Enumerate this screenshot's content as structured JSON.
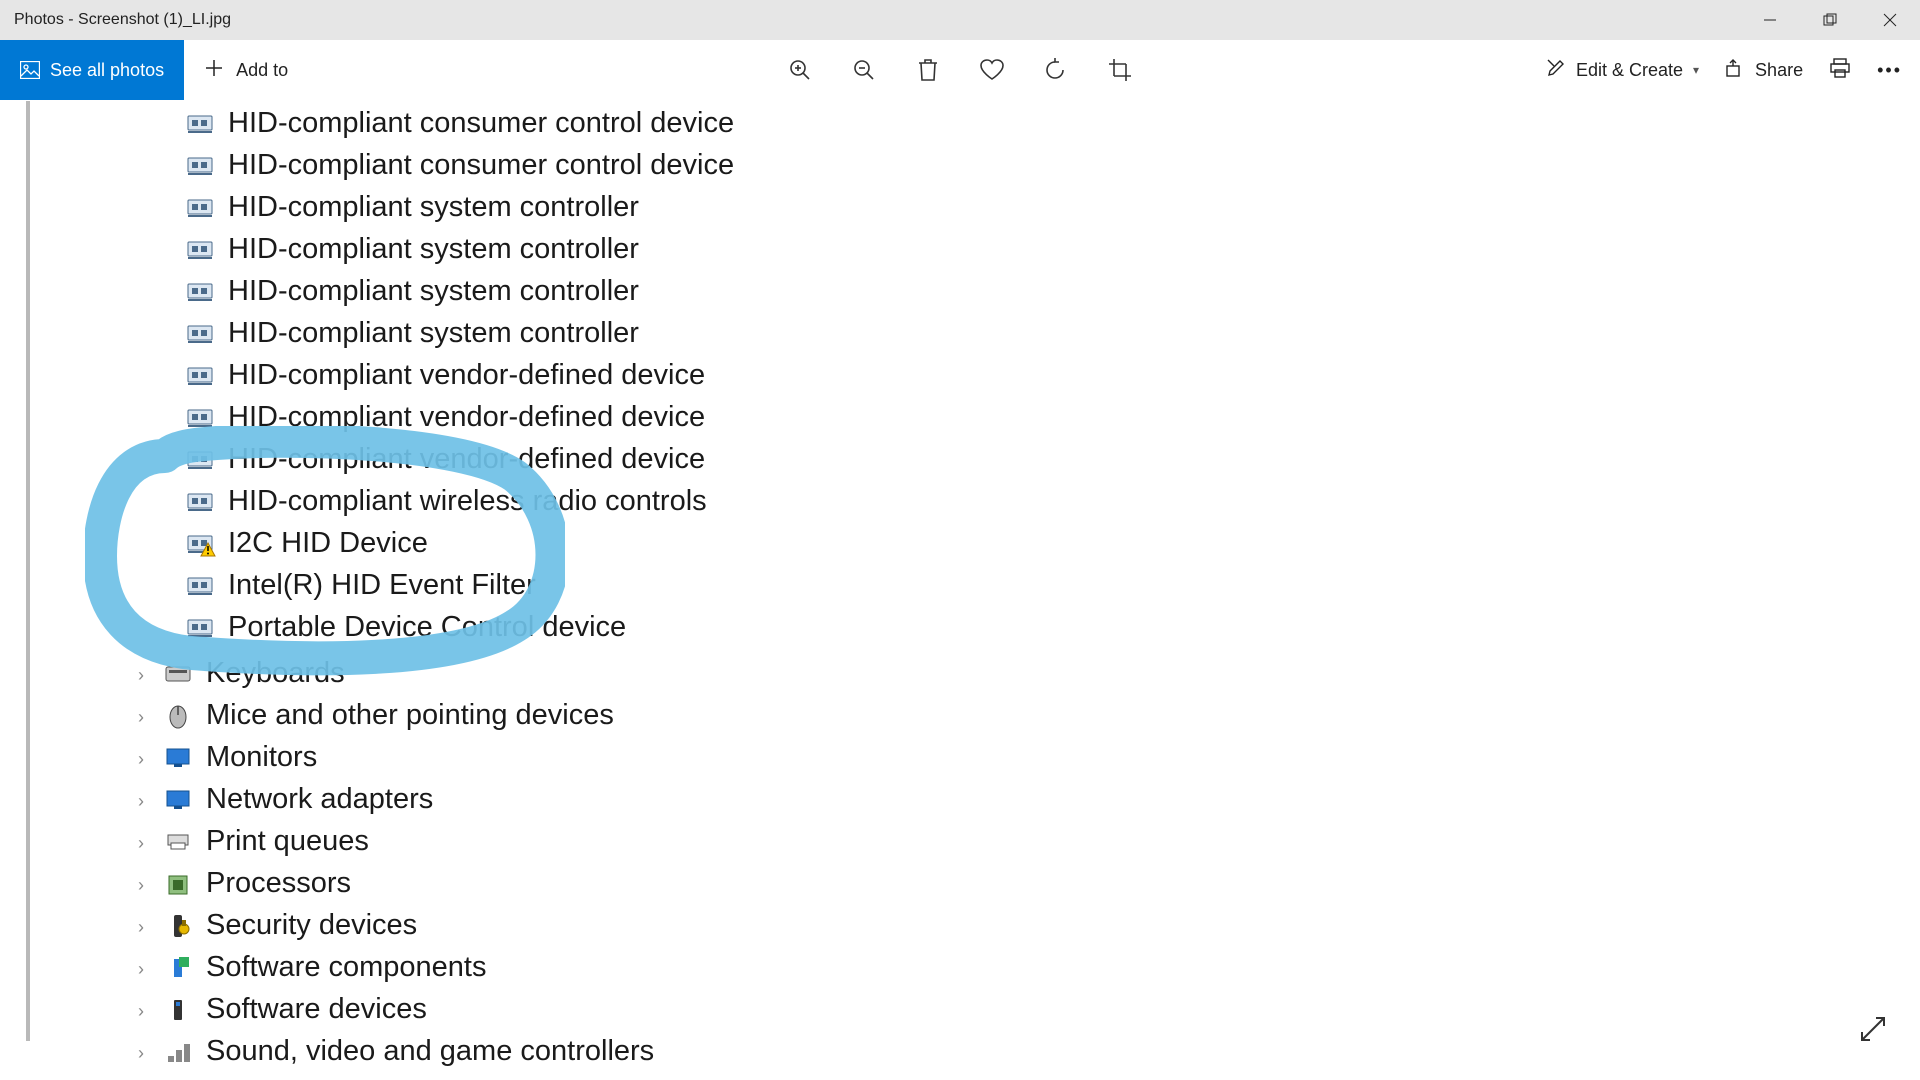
{
  "window": {
    "title": "Photos - Screenshot (1)_LI.jpg"
  },
  "appbar": {
    "see_all": "See all photos",
    "add_to": "Add to",
    "edit_create": "Edit & Create",
    "share": "Share"
  },
  "image_content": {
    "device_rows": [
      "HID-compliant consumer control device",
      "HID-compliant consumer control device",
      "HID-compliant system controller",
      "HID-compliant system controller",
      "HID-compliant system controller",
      "HID-compliant system controller",
      "HID-compliant vendor-defined device",
      "HID-compliant vendor-defined device",
      "HID-compliant vendor-defined device",
      "HID-compliant wireless radio controls",
      "I2C HID Device",
      "Intel(R) HID Event Filter",
      "Portable Device Control device"
    ],
    "categories": [
      "Keyboards",
      "Mice and other pointing devices",
      "Monitors",
      "Network adapters",
      "Print queues",
      "Processors",
      "Security devices",
      "Software components",
      "Software devices",
      "Sound, video and game controllers"
    ],
    "highlight_color": "#6ec0e6",
    "warning_device_index": 10
  }
}
